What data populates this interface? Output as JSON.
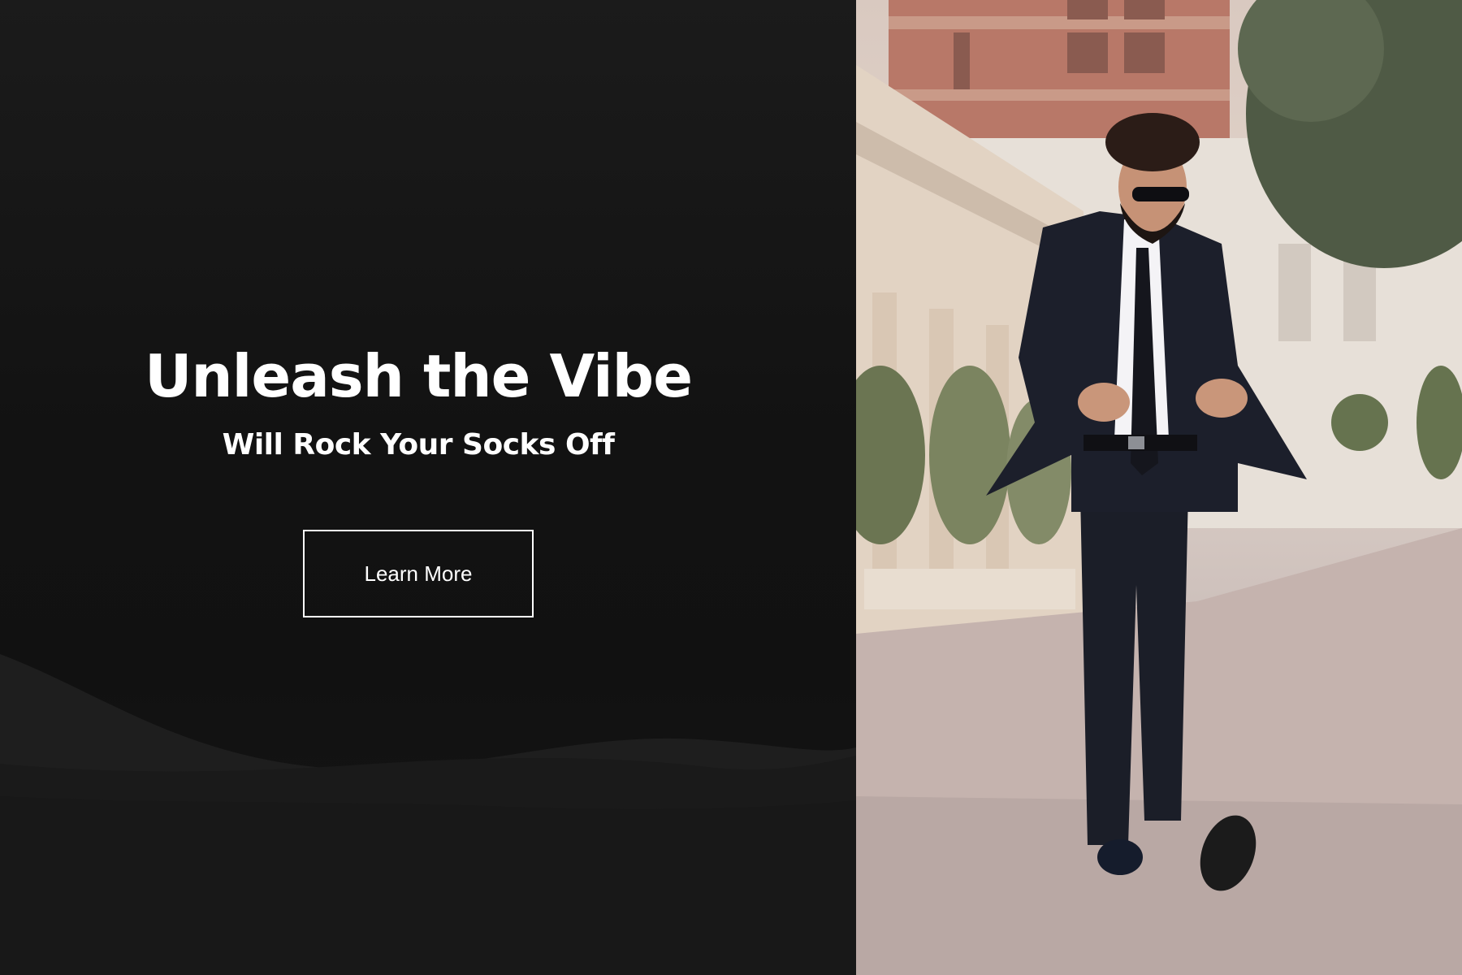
{
  "hero": {
    "title": "Unleash the Vibe",
    "subtitle": "Will Rock Your Socks Off",
    "cta_label": "Learn More"
  },
  "photo": {
    "subject": "man-in-black-suit-walking"
  },
  "colors": {
    "background_dark": "#141414",
    "text": "#ffffff",
    "button_border": "#ffffff"
  }
}
